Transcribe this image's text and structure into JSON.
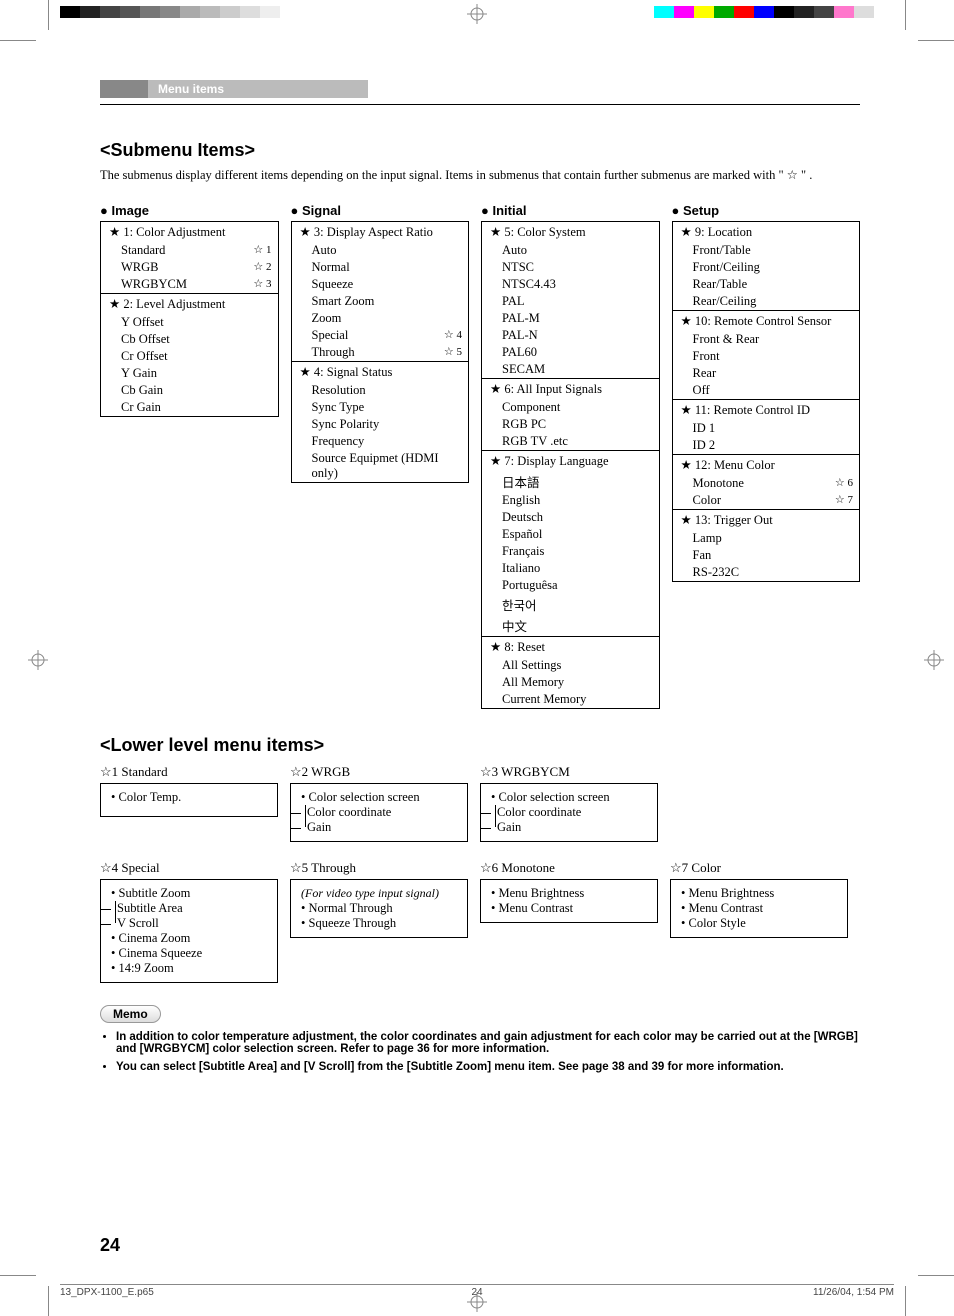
{
  "header_tab": "Menu items",
  "title_submenu": "<Submenu Items>",
  "intro": "The submenus display different items depending on the input signal. Items in submenus that contain further submenus are marked with \" ☆ \" .",
  "cols": {
    "image": {
      "title": "● Image",
      "sections": [
        {
          "hdr": "★ 1: Color Adjustment",
          "items": [
            {
              "label": "Standard",
              "mark": "☆ 1"
            },
            {
              "label": "WRGB",
              "mark": "☆ 2"
            },
            {
              "label": "WRGBYCM",
              "mark": "☆ 3"
            }
          ]
        },
        {
          "hdr": "★ 2: Level Adjustment",
          "items": [
            {
              "label": "Y Offset"
            },
            {
              "label": "Cb Offset"
            },
            {
              "label": "Cr Offset"
            },
            {
              "label": "Y Gain"
            },
            {
              "label": "Cb Gain"
            },
            {
              "label": "Cr Gain"
            }
          ]
        }
      ]
    },
    "signal": {
      "title": "● Signal",
      "sections": [
        {
          "hdr": "★ 3: Display Aspect Ratio",
          "items": [
            {
              "label": "Auto"
            },
            {
              "label": "Normal"
            },
            {
              "label": "Squeeze"
            },
            {
              "label": "Smart Zoom"
            },
            {
              "label": "Zoom"
            },
            {
              "label": "Special",
              "mark": "☆ 4"
            },
            {
              "label": "Through",
              "mark": "☆ 5"
            }
          ]
        },
        {
          "hdr": "★ 4: Signal Status",
          "items": [
            {
              "label": "Resolution"
            },
            {
              "label": "Sync Type"
            },
            {
              "label": "Sync Polarity"
            },
            {
              "label": "Frequency"
            },
            {
              "label": "Source Equipmet (HDMI only)"
            }
          ]
        }
      ]
    },
    "initial": {
      "title": "● Initial",
      "sections": [
        {
          "hdr": "★ 5: Color System",
          "items": [
            {
              "label": "Auto"
            },
            {
              "label": "NTSC"
            },
            {
              "label": "NTSC4.43"
            },
            {
              "label": "PAL"
            },
            {
              "label": "PAL-M"
            },
            {
              "label": "PAL-N"
            },
            {
              "label": "PAL60"
            },
            {
              "label": "SECAM"
            }
          ]
        },
        {
          "hdr": "★ 6: All Input Signals",
          "items": [
            {
              "label": "Component"
            },
            {
              "label": "RGB PC"
            },
            {
              "label": "RGB TV .etc"
            }
          ]
        },
        {
          "hdr": "★ 7: Display Language",
          "items": [
            {
              "label": "日本語"
            },
            {
              "label": "English"
            },
            {
              "label": "Deutsch"
            },
            {
              "label": "Español"
            },
            {
              "label": "Français"
            },
            {
              "label": "Italiano"
            },
            {
              "label": "Portuguêsa"
            },
            {
              "label": "한국어"
            },
            {
              "label": "中文"
            }
          ]
        },
        {
          "hdr": "★ 8: Reset",
          "items": [
            {
              "label": "All Settings"
            },
            {
              "label": "All Memory"
            },
            {
              "label": "Current Memory"
            }
          ]
        }
      ]
    },
    "setup": {
      "title": "● Setup",
      "sections": [
        {
          "hdr": "★ 9: Location",
          "items": [
            {
              "label": "Front/Table"
            },
            {
              "label": "Front/Ceiling"
            },
            {
              "label": "Rear/Table"
            },
            {
              "label": "Rear/Ceiling"
            }
          ]
        },
        {
          "hdr": "★ 10: Remote Control Sensor",
          "items": [
            {
              "label": "Front & Rear"
            },
            {
              "label": "Front"
            },
            {
              "label": "Rear"
            },
            {
              "label": "Off"
            }
          ]
        },
        {
          "hdr": "★ 11: Remote Control ID",
          "items": [
            {
              "label": "ID 1"
            },
            {
              "label": "ID 2"
            }
          ]
        },
        {
          "hdr": "★ 12: Menu Color",
          "items": [
            {
              "label": "Monotone",
              "mark": "☆ 6"
            },
            {
              "label": "Color",
              "mark": "☆ 7"
            }
          ]
        },
        {
          "hdr": "★ 13: Trigger Out",
          "items": [
            {
              "label": "Lamp"
            },
            {
              "label": "Fan"
            },
            {
              "label": "RS-232C"
            }
          ]
        }
      ]
    }
  },
  "title_lower": "<Lower level menu items>",
  "lower_row1": [
    {
      "title": "☆1 Standard",
      "items": [
        {
          "t": "• Color Temp."
        }
      ]
    },
    {
      "title": "☆2 WRGB",
      "items": [
        {
          "t": "• Color selection screen",
          "sub": [
            "Color coordinate",
            "Gain"
          ]
        }
      ]
    },
    {
      "title": "☆3 WRGBYCM",
      "items": [
        {
          "t": "• Color selection screen",
          "sub": [
            "Color coordinate",
            "Gain"
          ]
        }
      ]
    },
    {
      "title": "",
      "items": []
    }
  ],
  "lower_row2": [
    {
      "title": "☆4 Special",
      "items": [
        {
          "t": "• Subtitle Zoom",
          "sub": [
            "Subtitle Area",
            "V Scroll"
          ]
        },
        {
          "t": "• Cinema Zoom"
        },
        {
          "t": "• Cinema Squeeze"
        },
        {
          "t": "• 14:9 Zoom"
        }
      ]
    },
    {
      "title": "☆5 Through",
      "note": "(For video type input signal)",
      "items": [
        {
          "t": "• Normal Through"
        },
        {
          "t": "• Squeeze Through"
        }
      ]
    },
    {
      "title": "☆6 Monotone",
      "items": [
        {
          "t": "• Menu Brightness"
        },
        {
          "t": "• Menu Contrast"
        }
      ]
    },
    {
      "title": "☆7 Color",
      "items": [
        {
          "t": "• Menu Brightness"
        },
        {
          "t": "• Menu Contrast"
        },
        {
          "t": "• Color Style"
        }
      ]
    }
  ],
  "memo_label": "Memo",
  "memo": [
    "In addition to color temperature adjustment, the color coordinates and gain adjustment for each color may be carried out at the [WRGB] and [WRGBYCM] color selection screen. Refer to page 36 for more information.",
    "You can select [Subtitle Area] and [V Scroll] from the [Subtitle Zoom] menu item. See page 38 and 39 for more information."
  ],
  "pagenum": "24",
  "footer": {
    "left": "13_DPX-1100_E.p65",
    "center": "24",
    "right": "11/26/04, 1:54 PM"
  },
  "colorbar_left": [
    "#000",
    "#222",
    "#444",
    "#555",
    "#777",
    "#888",
    "#aaa",
    "#bbb",
    "#ccc",
    "#ddd",
    "#eee",
    "#fff"
  ],
  "colorbar_right": [
    "#0ff",
    "#f0f",
    "#ff0",
    "#0a0",
    "#f00",
    "#00f",
    "#000",
    "#222",
    "#444",
    "#f7c",
    "#ddd",
    "#fff"
  ]
}
